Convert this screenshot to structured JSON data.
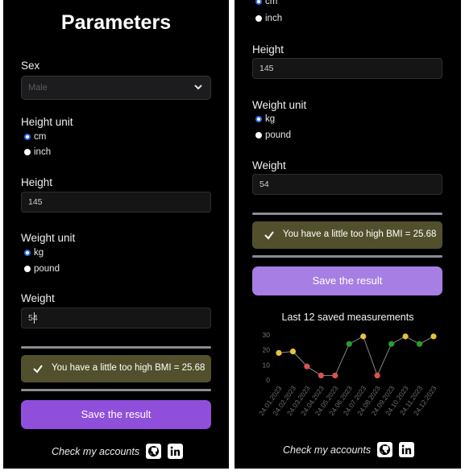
{
  "form": {
    "title": "Parameters",
    "sex_label": "Sex",
    "sex_value": "Male",
    "height_unit_label": "Height unit",
    "height_units": [
      "cm",
      "inch"
    ],
    "height_unit_selected": "cm",
    "height_label": "Height",
    "height_value": "145",
    "weight_unit_label": "Weight unit",
    "weight_units": [
      "kg",
      "pound"
    ],
    "weight_unit_selected": "kg",
    "weight_label": "Weight",
    "weight_value": "54"
  },
  "result": {
    "message": "You have a little too high BMI = 25.68",
    "save_label": "Save the result"
  },
  "footer": {
    "text": "Check my accounts",
    "icons": [
      "github-icon",
      "linkedin-icon"
    ]
  },
  "colors": {
    "panel_bg": "#000000",
    "alert_bg": "#52502c",
    "save_button": "#8f4fdb",
    "save_button_light": "#a77ee3",
    "status_yellow": "#e8c23c",
    "status_red": "#d9544f",
    "status_green": "#2a9d2a",
    "radio_selected": "#2a6df0"
  },
  "chart_data": {
    "type": "line",
    "title": "Last 12 saved measurements",
    "categories": [
      "24.01.2023",
      "24.02.2023",
      "24.03.2023",
      "24.04.2023",
      "24.05.2023",
      "24.06.2023",
      "24.07.2023",
      "24.08.2023",
      "24.09.2023",
      "24.10.2023",
      "24.11.2023",
      "24.12.2023"
    ],
    "values": [
      18,
      19,
      9,
      3,
      3,
      24,
      29,
      3,
      24,
      29,
      24,
      29
    ],
    "point_status": [
      "yellow",
      "yellow",
      "red",
      "red",
      "red",
      "green",
      "yellow",
      "red",
      "green",
      "yellow",
      "green",
      "yellow"
    ],
    "yticks": [
      0,
      10,
      20,
      30
    ],
    "ylim": [
      0,
      30
    ],
    "grid": false,
    "legend": "none"
  }
}
